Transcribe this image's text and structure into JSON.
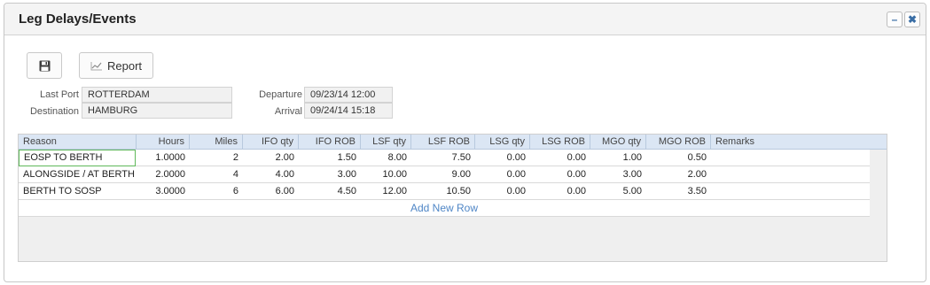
{
  "window": {
    "title": "Leg Delays/Events"
  },
  "toolbar": {
    "report_label": "Report"
  },
  "info": {
    "last_port_label": "Last Port",
    "last_port_value": "ROTTERDAM",
    "destination_label": "Destination",
    "destination_value": "HAMBURG",
    "departure_label": "Departure",
    "departure_value": "09/23/14 12:00",
    "arrival_label": "Arrival",
    "arrival_value": "09/24/14 15:18"
  },
  "grid": {
    "columns": [
      "Reason",
      "Hours",
      "Miles",
      "IFO qty",
      "IFO ROB",
      "LSF qty",
      "LSF ROB",
      "LSG qty",
      "LSG ROB",
      "MGO qty",
      "MGO ROB",
      "Remarks"
    ],
    "rows": [
      [
        "EOSP TO BERTH",
        "1.0000",
        "2",
        "2.00",
        "1.50",
        "8.00",
        "7.50",
        "0.00",
        "0.00",
        "1.00",
        "0.50",
        ""
      ],
      [
        "ALONGSIDE / AT BERTH",
        "2.0000",
        "4",
        "4.00",
        "3.00",
        "10.00",
        "9.00",
        "0.00",
        "0.00",
        "3.00",
        "2.00",
        ""
      ],
      [
        "BERTH TO SOSP",
        "3.0000",
        "6",
        "6.00",
        "4.50",
        "12.00",
        "10.50",
        "0.00",
        "0.00",
        "5.00",
        "3.50",
        ""
      ]
    ],
    "add_row_label": "Add New Row"
  }
}
